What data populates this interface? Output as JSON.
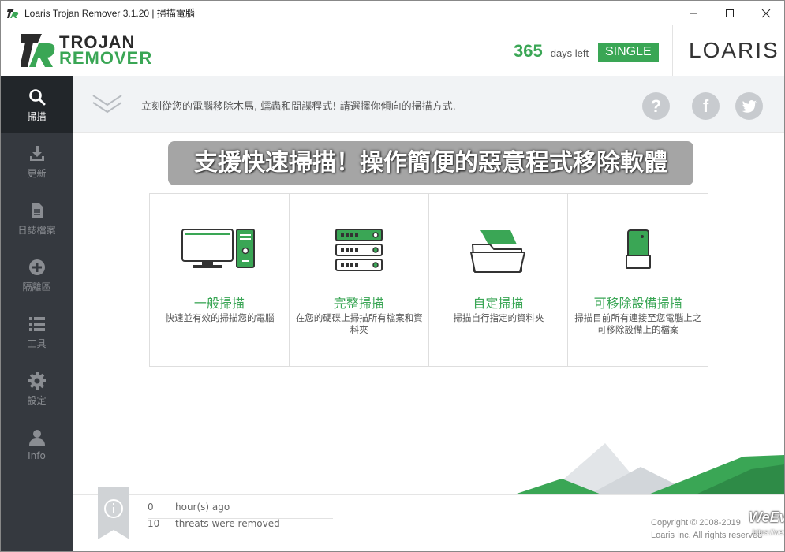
{
  "window": {
    "title": "Loaris Trojan Remover 3.1.20 | 掃描電腦"
  },
  "header": {
    "logo_line1": "TROJAN",
    "logo_line2": "REMOVER",
    "days_count": "365",
    "days_label": "days left",
    "license": "SINGLE",
    "brand": "LOARIS"
  },
  "sidebar": {
    "items": [
      {
        "label": "掃描",
        "icon": "search-icon",
        "active": true
      },
      {
        "label": "更新",
        "icon": "download-icon",
        "active": false
      },
      {
        "label": "日誌檔案",
        "icon": "document-icon",
        "active": false
      },
      {
        "label": "隔離區",
        "icon": "plus-circle-icon",
        "active": false
      },
      {
        "label": "工具",
        "icon": "list-icon",
        "active": false
      },
      {
        "label": "設定",
        "icon": "gear-icon",
        "active": false
      },
      {
        "label": "Info",
        "icon": "user-icon",
        "active": false
      }
    ]
  },
  "banner": {
    "message": "立刻從您的電腦移除木馬, 蠕蟲和間諜程式! 請選擇你傾向的掃描方式.",
    "help": "?",
    "facebook": "f"
  },
  "overlay_title": "支援快速掃描！操作簡便的惡意程式移除軟體",
  "scan_types": [
    {
      "title": "一般掃描",
      "desc": "快速並有效的掃描您的電腦",
      "icon": "computer-icon"
    },
    {
      "title": "完整掃描",
      "desc": "在您的硬碟上掃描所有檔案和資料夾",
      "icon": "server-icon"
    },
    {
      "title": "自定掃描",
      "desc": "掃描自行指定的資料夾",
      "icon": "folder-icon"
    },
    {
      "title": "可移除設備掃描",
      "desc": "掃描目前所有連接至您電腦上之可移除設備上的檔案",
      "icon": "usb-drive-icon"
    }
  ],
  "footer": {
    "last_scan_value": "0",
    "last_scan_label": "hour(s) ago",
    "threats_value": "10",
    "threats_label": "threats were removed",
    "copyright_line1": "Copyright © 2008-2019",
    "copyright_line2": "Loaris Inc. All rights reserved",
    "watermark": "WeEvent",
    "watermark_url": "https://weevent.net/"
  },
  "colors": {
    "accent": "#3aa655",
    "sidebar": "#35393f",
    "sidebar_active": "#22262a"
  }
}
